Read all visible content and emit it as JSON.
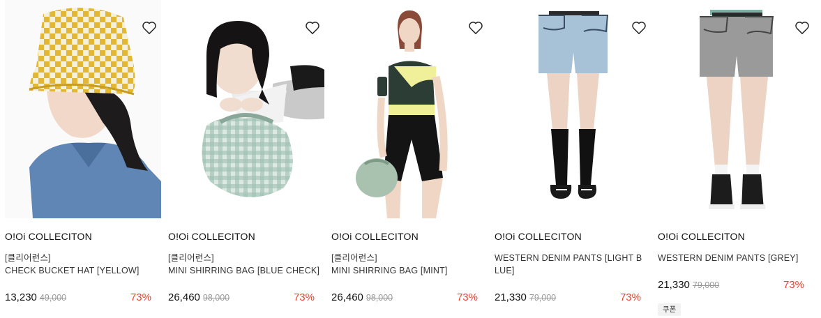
{
  "products": [
    {
      "brand": "O!Oi COLLECITON",
      "category": "[클리어런스]",
      "name_line1": "CHECK BUCKET HAT [YELLOW]",
      "name_line2": "",
      "price": "13,230",
      "original_price": "49,000",
      "discount": "73%",
      "coupon": ""
    },
    {
      "brand": "O!Oi COLLECITON",
      "category": "[클리어런스]",
      "name_line1": "MINI SHIRRING BAG [BLUE CHECK]",
      "name_line2": "",
      "price": "26,460",
      "original_price": "98,000",
      "discount": "73%",
      "coupon": ""
    },
    {
      "brand": "O!Oi COLLECITON",
      "category": "[클리어런스]",
      "name_line1": "MINI SHIRRING BAG [MINT]",
      "name_line2": "",
      "price": "26,460",
      "original_price": "98,000",
      "discount": "73%",
      "coupon": ""
    },
    {
      "brand": "O!Oi COLLECITON",
      "category": "",
      "name_line1": "WESTERN DENIM PANTS [LIGHT B",
      "name_line2": "LUE]",
      "price": "21,330",
      "original_price": "79,000",
      "discount": "73%",
      "coupon": ""
    },
    {
      "brand": "O!Oi COLLECITON",
      "category": "",
      "name_line1": "WESTERN DENIM PANTS [GREY]",
      "name_line2": "",
      "price": "21,330",
      "original_price": "79,000",
      "discount": "73%",
      "coupon": "쿠폰"
    }
  ],
  "icons": {
    "wishlist": "heart-outline-icon"
  },
  "colors": {
    "discount": "#e8432e",
    "original_price": "#999999",
    "coupon_bg": "#f2f2f2"
  }
}
